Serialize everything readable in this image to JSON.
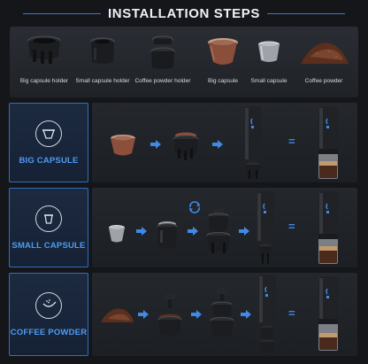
{
  "title": "INSTALLATION STEPS",
  "parts": [
    {
      "label": "Big capsule holder",
      "icon": "big-capsule-holder-icon"
    },
    {
      "label": "Small capsule holder",
      "icon": "small-capsule-holder-icon"
    },
    {
      "label": "Coffee powder holder",
      "icon": "coffee-powder-holder-icon"
    },
    {
      "label": "Big capsule",
      "icon": "big-capsule-icon"
    },
    {
      "label": "Small capsule",
      "icon": "small-capsule-icon"
    },
    {
      "label": "Coffee powder",
      "icon": "coffee-powder-icon"
    }
  ],
  "rows": [
    {
      "name": "BIG CAPSULE",
      "icon": "big-capsule-icon"
    },
    {
      "name": "SMALL CAPSULE",
      "icon": "small-capsule-icon"
    },
    {
      "name": "COFFEE POWDER",
      "icon": "coffee-powder-icon"
    }
  ],
  "equals": "=",
  "colors": {
    "accent": "#3f8ae6",
    "background": "#14161a",
    "panel": "#24272c"
  }
}
